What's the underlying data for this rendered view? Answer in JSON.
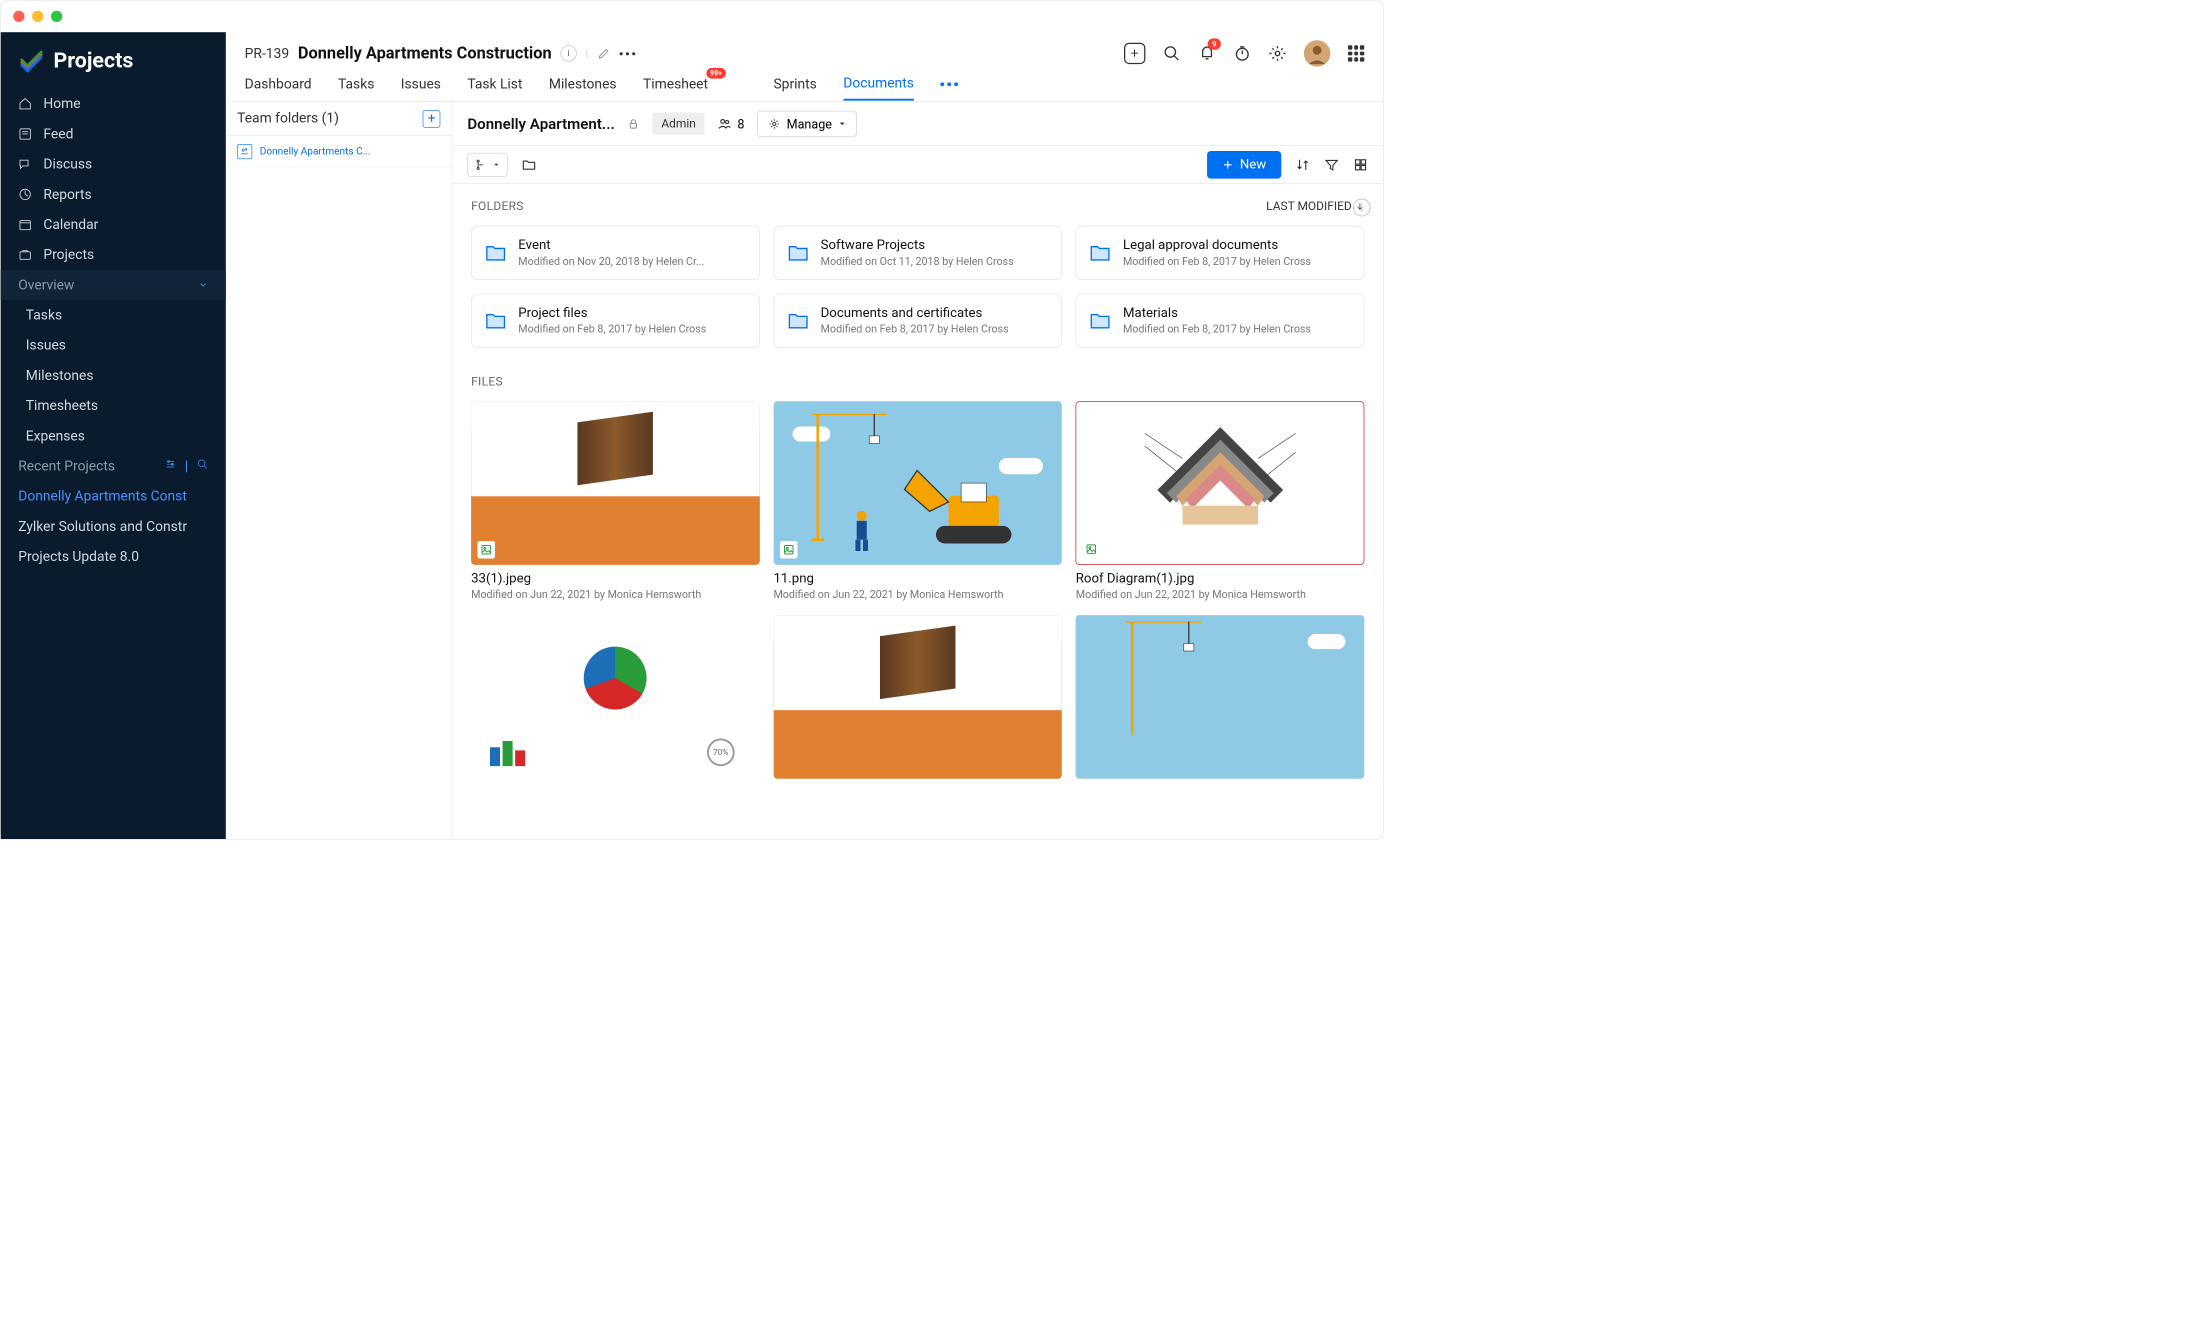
{
  "app_name": "Projects",
  "nav": [
    {
      "label": "Home",
      "icon": "home"
    },
    {
      "label": "Feed",
      "icon": "feed"
    },
    {
      "label": "Discuss",
      "icon": "chat"
    },
    {
      "label": "Reports",
      "icon": "gauge"
    },
    {
      "label": "Calendar",
      "icon": "calendar"
    },
    {
      "label": "Projects",
      "icon": "briefcase"
    }
  ],
  "overview_label": "Overview",
  "overview_items": [
    "Tasks",
    "Issues",
    "Milestones",
    "Timesheets",
    "Expenses"
  ],
  "recent_label": "Recent Projects",
  "recent_items": [
    "Donnelly Apartments Const",
    "Zylker Solutions and Constr",
    "Projects Update 8.0"
  ],
  "project_id": "PR-139",
  "project_title": "Donnelly Apartments Construction",
  "tabs": [
    "Dashboard",
    "Tasks",
    "Issues",
    "Task List",
    "Milestones",
    "Timesheet",
    "Sprints",
    "Documents"
  ],
  "active_tab": "Documents",
  "timesheet_badge": "99+",
  "notif_badge": "9",
  "team_folders_label": "Team folders (1)",
  "team_folder_items": [
    "Donnelly Apartments C..."
  ],
  "doc_header": {
    "title": "Donnelly Apartment...",
    "admin_label": "Admin",
    "member_count": "8",
    "manage_label": "Manage"
  },
  "new_btn_label": "New",
  "folders_label": "FOLDERS",
  "files_label": "FILES",
  "sort_label": "LAST MODIFIED",
  "folders": [
    {
      "name": "Event",
      "meta": "Modified on Nov 20, 2018 by Helen Cr..."
    },
    {
      "name": "Software Projects",
      "meta": "Modified on Oct 11, 2018 by Helen Cross"
    },
    {
      "name": "Legal approval documents",
      "meta": "Modified on Feb 8, 2017 by Helen Cross"
    },
    {
      "name": "Project files",
      "meta": "Modified on Feb 8, 2017 by Helen Cross"
    },
    {
      "name": "Documents and certificates",
      "meta": "Modified on Feb 8, 2017 by Helen Cross"
    },
    {
      "name": "Materials",
      "meta": "Modified on Feb 8, 2017 by Helen Cross"
    }
  ],
  "files": [
    {
      "name": "33(1).jpeg",
      "meta": "Modified on Jun 22, 2021 by Monica Hemsworth"
    },
    {
      "name": "11.png",
      "meta": "Modified on Jun 22, 2021 by Monica Hemsworth"
    },
    {
      "name": "Roof Diagram(1).jpg",
      "meta": "Modified on Jun 22, 2021 by Monica Hemsworth"
    }
  ]
}
